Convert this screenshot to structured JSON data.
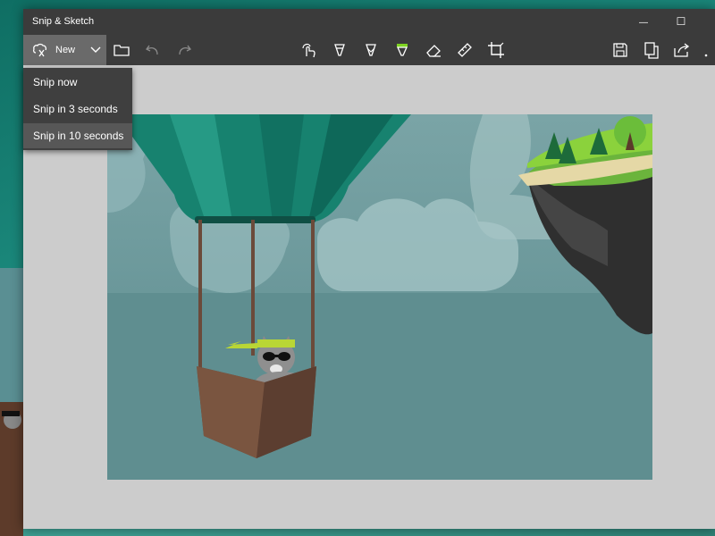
{
  "window": {
    "title": "Snip & Sketch",
    "minimize_symbol": "—",
    "maximize_symbol": "☐",
    "close_symbol": "✕"
  },
  "toolbar": {
    "new_label": "New",
    "new_icon": "snip-icon",
    "tools": [
      {
        "name": "open-folder-icon"
      },
      {
        "name": "undo-icon"
      },
      {
        "name": "redo-icon"
      },
      {
        "name": "touch-writing-icon"
      },
      {
        "name": "ballpoint-pen-icon"
      },
      {
        "name": "pencil-icon"
      },
      {
        "name": "highlighter-icon",
        "accent": "#7ed321"
      },
      {
        "name": "eraser-icon"
      },
      {
        "name": "ruler-icon"
      },
      {
        "name": "crop-icon"
      },
      {
        "name": "save-icon"
      },
      {
        "name": "copy-icon"
      },
      {
        "name": "share-icon"
      },
      {
        "name": "more-icon"
      }
    ]
  },
  "new_menu": {
    "items": [
      {
        "label": "Snip now"
      },
      {
        "label": "Snip in 3 seconds"
      },
      {
        "label": "Snip in 10 seconds"
      }
    ]
  },
  "colors": {
    "titlebar": "#3b3b3b",
    "new_button": "#6a6a6a",
    "menu": "#3f3f3f",
    "menu_hover": "#575757",
    "canvas": "#cccccc",
    "balloon": "#17826f",
    "highlighter_green": "#7ed321"
  }
}
